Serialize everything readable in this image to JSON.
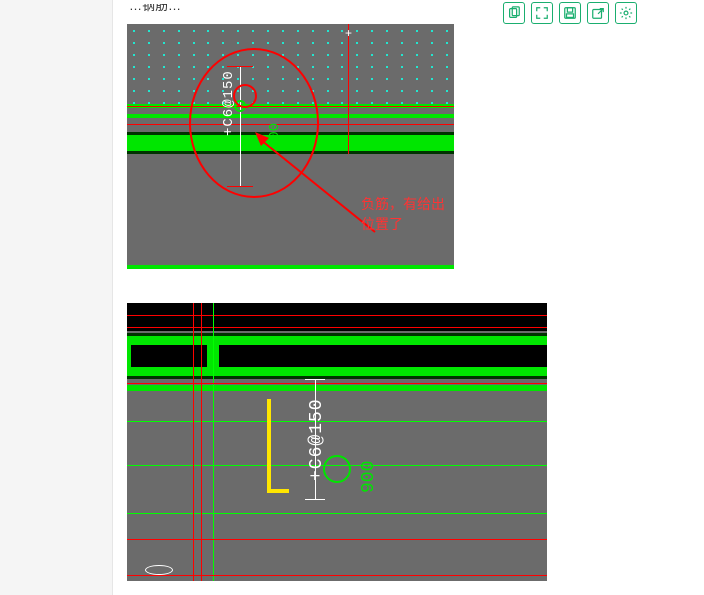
{
  "title_truncated": "…钢筋…",
  "toolbar": {
    "copy": "copy-icon",
    "expand": "expand-icon",
    "save": "save-icon",
    "share": "share-icon",
    "settings": "settings-icon"
  },
  "image1": {
    "rebar_label": "+C6@150",
    "dim_green": "900",
    "annotation": "负筋，有给出位置了"
  },
  "image2": {
    "rebar_label": "+C6@150",
    "dim_green": "900"
  }
}
